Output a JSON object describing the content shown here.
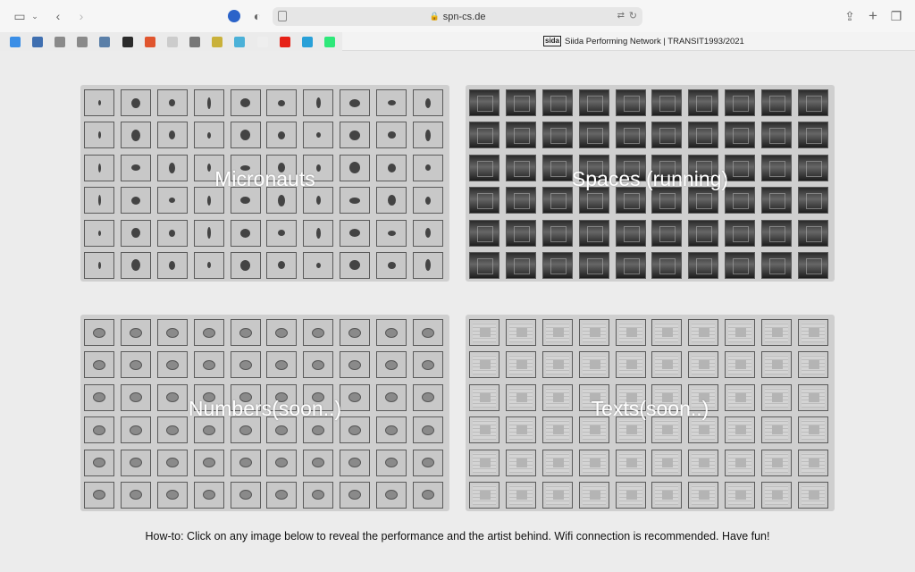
{
  "browser": {
    "url": "spn-cs.de",
    "tab_title": "Siida Performing Network | TRANSIT1993/2021",
    "tab_logo": "sida",
    "favicon_colors": [
      "#3a8ee6",
      "#3f6fb0",
      "#8a8a8a",
      "#8a8a8a",
      "#5a7fa8",
      "#2b2b2b",
      "#e0552e",
      "#cccccc",
      "#777777",
      "#c9b13a",
      "#4bb1d8",
      "#eeeeee",
      "#e62117",
      "#28a0d8",
      "#2ee87a"
    ]
  },
  "panels": [
    {
      "label": "Micronauts",
      "kind": "bug"
    },
    {
      "label": "Spaces (running)",
      "kind": "space"
    },
    {
      "label": "Numbers(soon..)",
      "kind": "coin"
    },
    {
      "label": "Texts(soon..)",
      "kind": "txt"
    }
  ],
  "howto": "How-to: Click on any image below to reveal the performance and the artist behind. Wifi connection is recommended. Have fun!"
}
